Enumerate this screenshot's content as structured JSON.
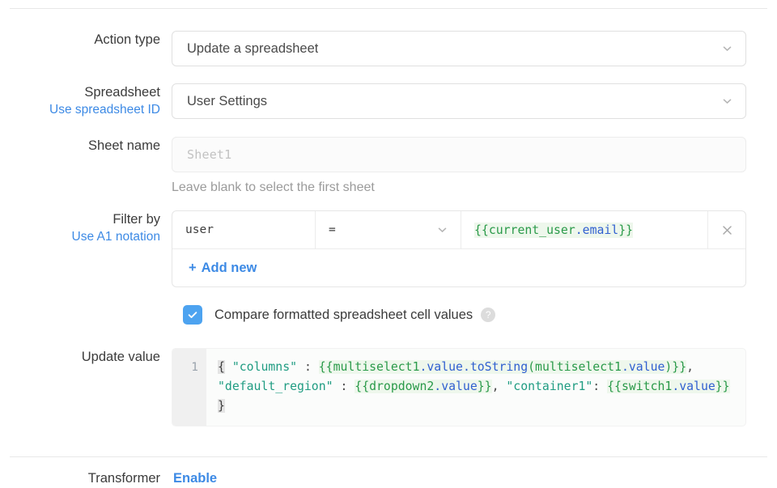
{
  "form": {
    "action_type": {
      "label": "Action type",
      "value": "Update a spreadsheet",
      "icon": "chevron-down-icon"
    },
    "spreadsheet": {
      "label": "Spreadsheet",
      "sublink": "Use spreadsheet ID",
      "value": "User Settings",
      "icon": "chevron-down-icon"
    },
    "sheet_name": {
      "label": "Sheet name",
      "placeholder": "Sheet1",
      "value": "",
      "helper": "Leave blank to select the first sheet"
    },
    "filter_by": {
      "label": "Filter by",
      "sublink": "Use A1 notation",
      "rows": [
        {
          "key": "user",
          "operator": "=",
          "value_expr": {
            "open": "{{",
            "object": "current_user",
            "dot": ".",
            "property": "email",
            "close": "}}"
          },
          "delete_icon": "close-icon",
          "operator_icon": "chevron-down-icon"
        }
      ],
      "add_new_label": "Add new",
      "add_new_plus": "+"
    },
    "compare_checkbox": {
      "label": "Compare formatted spreadsheet cell values",
      "checked": true,
      "help_icon": "help-circle-icon",
      "help_glyph": "?"
    },
    "update_value": {
      "label": "Update value",
      "line_number": "1",
      "code_tokens": [
        {
          "t": "{",
          "k": "brace-highlight"
        },
        {
          "t": " ",
          "k": "plain"
        },
        {
          "t": "\"columns\"",
          "k": "string"
        },
        {
          "t": " : ",
          "k": "punc"
        },
        {
          "t": "{{multiselect1",
          "k": "bind"
        },
        {
          "t": ".value",
          "k": "bind-prop"
        },
        {
          "t": ".toString",
          "k": "bind-prop"
        },
        {
          "t": "(multiselect1",
          "k": "bind"
        },
        {
          "t": ".value",
          "k": "bind-prop"
        },
        {
          "t": ")}}",
          "k": "bind"
        },
        {
          "t": ", ",
          "k": "punc"
        },
        {
          "t": "\"default_region\"",
          "k": "string"
        },
        {
          "t": " : ",
          "k": "punc"
        },
        {
          "t": "{{dropdown2",
          "k": "bind"
        },
        {
          "t": ".value",
          "k": "bind-prop"
        },
        {
          "t": "}}",
          "k": "bind"
        },
        {
          "t": ", ",
          "k": "punc"
        },
        {
          "t": "\"container1\"",
          "k": "string"
        },
        {
          "t": ": ",
          "k": "punc"
        },
        {
          "t": "{{switch1",
          "k": "bind"
        },
        {
          "t": ".value",
          "k": "bind-prop"
        },
        {
          "t": "}}",
          "k": "bind"
        },
        {
          "t": " ",
          "k": "plain"
        },
        {
          "t": "}",
          "k": "brace-highlight"
        }
      ],
      "code_plain": "{ \"columns\" : {{multiselect1.value.toString(multiselect1.value)}}, \"default_region\" : {{dropdown2.value}}, \"container1\": {{switch1.value}} }"
    },
    "transformer": {
      "label": "Transformer",
      "enable_label": "Enable"
    }
  },
  "colors": {
    "link": "#3d8ae5",
    "checkbox_accent": "#4da3f0",
    "binding_text": "#2a9a49",
    "binding_bg": "#eef7ec",
    "property_text": "#2f5fd0",
    "string_text": "#1f9c82",
    "border": "#e0e0e0"
  }
}
